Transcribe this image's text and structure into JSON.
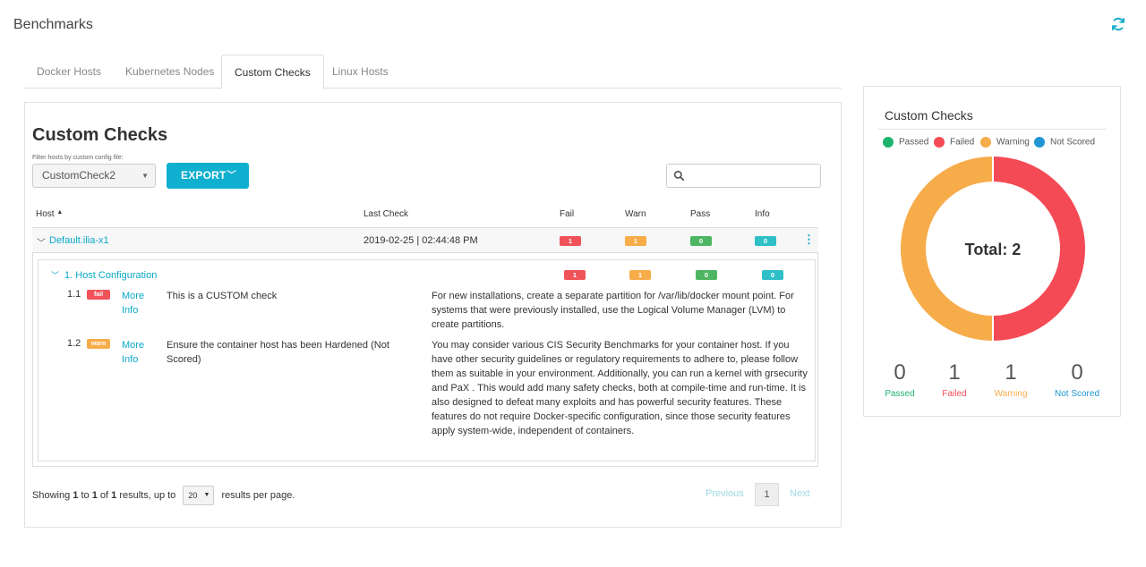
{
  "page": {
    "title": "Benchmarks"
  },
  "tabs": [
    {
      "label": "Docker Hosts",
      "active": false
    },
    {
      "label": "Kubernetes Nodes",
      "active": false
    },
    {
      "label": "Custom Checks",
      "active": true
    },
    {
      "label": "Linux Hosts",
      "active": false
    }
  ],
  "main": {
    "title": "Custom Checks",
    "filter_label": "Filter hosts by custom config file:",
    "filter_value": "CustomCheck2",
    "export_label": "EXPORT",
    "search_placeholder": "",
    "columns": {
      "host": "Host",
      "last_check": "Last Check",
      "fail": "Fail",
      "warn": "Warn",
      "pass": "Pass",
      "info": "Info"
    },
    "host_row": {
      "host": "Default.ilia-x1",
      "last_check": "2019-02-25 | 02:44:48 PM",
      "fail": "1",
      "warn": "1",
      "pass": "0",
      "info": "0"
    },
    "group": {
      "title": "1. Host Configuration",
      "fail": "1",
      "warn": "1",
      "pass": "0",
      "info": "0"
    },
    "checks": [
      {
        "num": "1.1",
        "status": "fail",
        "more_info": "More Info",
        "description": "This is a CUSTOM check",
        "remediation": "For new installations, create a separate partition for /var/lib/docker mount point. For systems that were previously installed, use the Logical Volume Manager (LVM) to create partitions."
      },
      {
        "num": "1.2",
        "status": "warn",
        "more_info": "More Info",
        "description": "Ensure the container host has been Hardened (Not Scored)",
        "remediation": "You may consider various CIS Security Benchmarks for your container host. If you have other security guidelines or regulatory requirements to adhere to, please follow them as suitable in your environment. Additionally, you can run a kernel with grsecurity and PaX . This would add many safety checks, both at compile-time and run-time. It is also designed to defeat many exploits and has powerful security features. These features do not require Docker-specific configuration, since those security features apply system-wide, independent of containers."
      }
    ],
    "footer": {
      "showing": "Showing",
      "from": "1",
      "to_word": "to",
      "to": "1",
      "of_word": "of",
      "total": "1",
      "results_up_to": "results, up to",
      "page_size": "20",
      "per_page": "results per page.",
      "previous": "Previous",
      "current_page": "1",
      "next": "Next"
    }
  },
  "side": {
    "title": "Custom Checks",
    "legend": [
      {
        "label": "Passed",
        "color": "#1db36b"
      },
      {
        "label": "Failed",
        "color": "#f44a55"
      },
      {
        "label": "Warning",
        "color": "#f7ac4a"
      },
      {
        "label": "Not Scored",
        "color": "#2196d3"
      }
    ],
    "total_label": "Total: 2",
    "donut": {
      "passed": 0,
      "failed": 1,
      "warning": 1,
      "not_scored": 0
    },
    "stats": [
      {
        "value": "0",
        "label": "Passed",
        "color": "#1db36b"
      },
      {
        "value": "1",
        "label": "Failed",
        "color": "#f44a55"
      },
      {
        "value": "1",
        "label": "Warning",
        "color": "#f7ac4a"
      },
      {
        "value": "0",
        "label": "Not Scored",
        "color": "#2196d3"
      }
    ]
  }
}
